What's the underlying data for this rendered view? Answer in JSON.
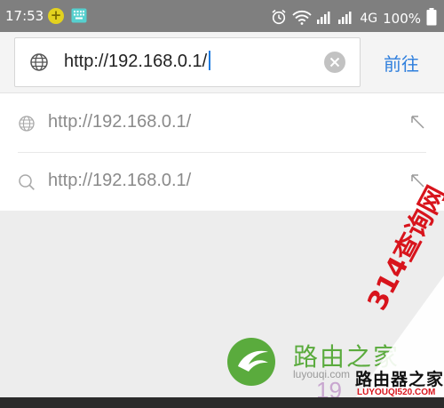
{
  "status_bar": {
    "time": "17:53",
    "network": "4G",
    "battery": "100%",
    "icons": [
      "plus-badge-icon",
      "keyboard-icon",
      "alarm-icon",
      "wifi-icon",
      "signal-icon",
      "signal-icon",
      "battery-icon"
    ]
  },
  "address_bar": {
    "url_value": "http://192.168.0.1/",
    "go_label": "前往",
    "accent_color": "#2f7fdd"
  },
  "suggestions": [
    {
      "type": "history",
      "icon": "globe-icon",
      "text": "http://192.168.0.1/"
    },
    {
      "type": "search",
      "icon": "search-icon",
      "text": "http://192.168.0.1/"
    }
  ],
  "watermark": {
    "brand": "路由之家",
    "domain": "luyouqi.com",
    "number": "19",
    "corner_red": "314查询网",
    "corner_black": "路由器之家",
    "corner_small": "LUYOUQI520.COM"
  }
}
